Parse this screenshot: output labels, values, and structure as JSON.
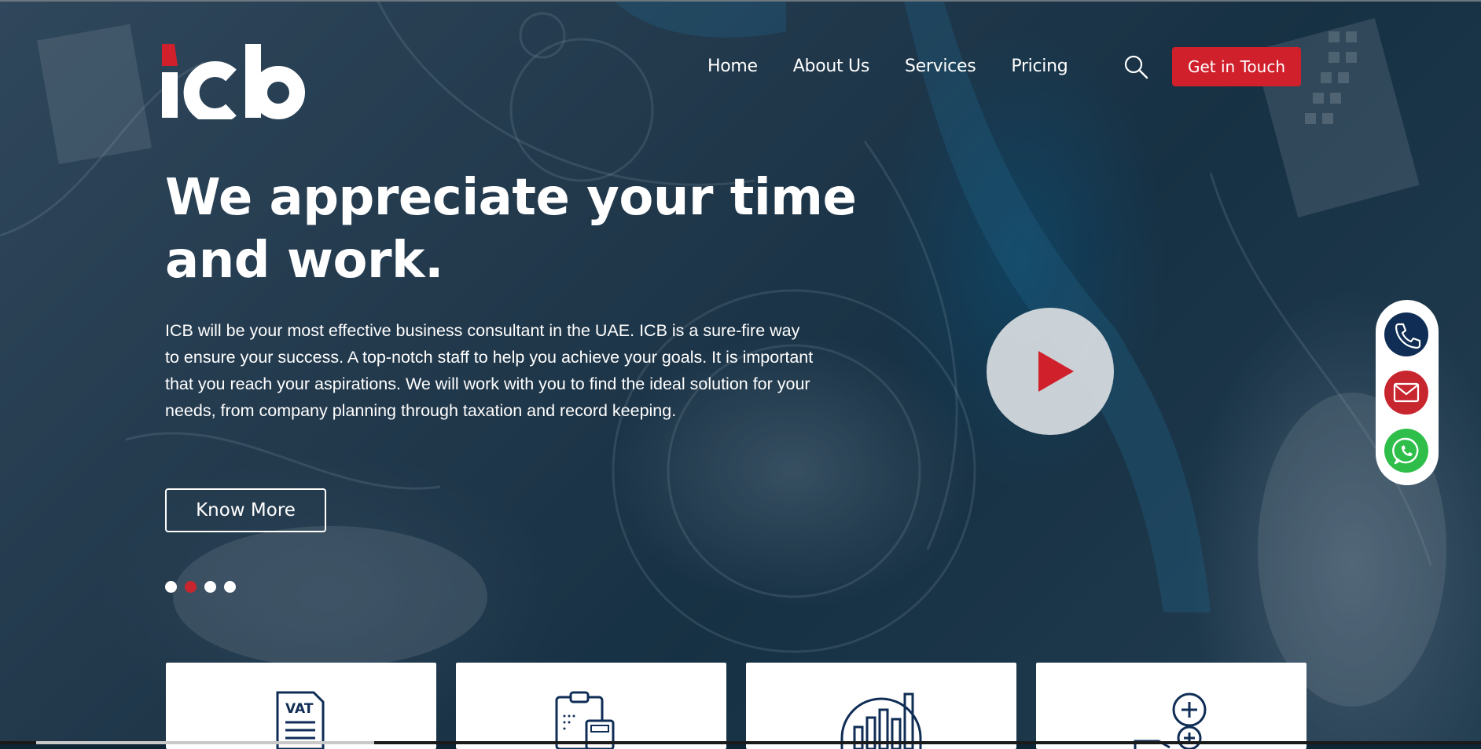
{
  "brand": {
    "logo_text": "icb",
    "colors": {
      "accent": "#d0202c",
      "navy": "#0f2d55",
      "whatsapp": "#2fbe4a"
    }
  },
  "nav": {
    "items": [
      {
        "label": "Home"
      },
      {
        "label": "About Us"
      },
      {
        "label": "Services"
      },
      {
        "label": "Pricing"
      }
    ],
    "search_icon": "search-icon",
    "cta_label": "Get in Touch"
  },
  "hero": {
    "headline_line1": "We appreciate your time",
    "headline_line2": "and work.",
    "description": "ICB will be your most effective business consultant in the UAE. ICB is a sure-fire way to ensure your success. A top-notch staff to help you achieve your goals. It is important that you reach your aspirations. We will work with you to find the ideal solution for your needs, from company planning through taxation and record keeping.",
    "button_label": "Know More",
    "slides": {
      "count": 4,
      "active_index": 1
    },
    "play_icon": "play-icon"
  },
  "contact_widget": {
    "icons": [
      "phone-icon",
      "mail-icon",
      "whatsapp-icon"
    ]
  },
  "service_cards": [
    {
      "icon": "vat-document-icon",
      "icon_text": "VAT"
    },
    {
      "icon": "clipboard-calculator-icon"
    },
    {
      "icon": "bar-chart-icon"
    },
    {
      "icon": "plus-coins-icon"
    }
  ]
}
